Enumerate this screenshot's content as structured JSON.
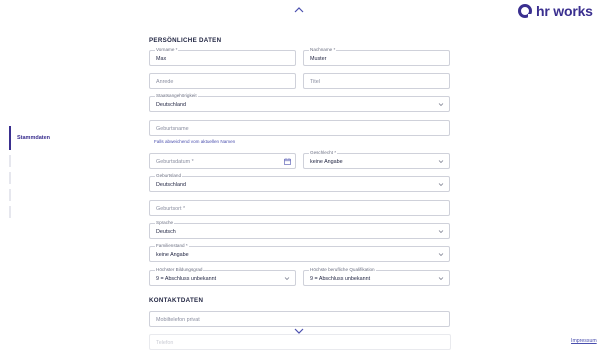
{
  "brand": {
    "logo_text": "hr works",
    "color": "#3a2f8f"
  },
  "nav": {
    "scroll_up_icon": "chevron-up-icon",
    "scroll_down_icon": "chevron-down-icon",
    "sidebar": {
      "active_label": "Stammdaten"
    }
  },
  "sections": {
    "personal": "PERSÖNLICHE DATEN",
    "contact": "KONTAKTDATEN"
  },
  "fields": {
    "vorname": {
      "label": "Vorname *",
      "value": "Max"
    },
    "nachname": {
      "label": "Nachname *",
      "value": "Muster"
    },
    "anrede": {
      "placeholder": "Anrede"
    },
    "titel": {
      "placeholder": "Titel"
    },
    "staatsangehoerigkeit": {
      "label": "Staatsangehörigkeit",
      "value": "Deutschland"
    },
    "geburtsname": {
      "placeholder": "Geburtsname",
      "hint": "Falls abweichend vom aktuellen Namen"
    },
    "geburtsdatum": {
      "placeholder": "Geburtsdatum *"
    },
    "geschlecht": {
      "label": "Geschlecht *",
      "value": "keine Angabe"
    },
    "geburtsland": {
      "label": "Geburtsland",
      "value": "Deutschland"
    },
    "geburtsort": {
      "placeholder": "Geburtsort *"
    },
    "sprache": {
      "label": "Sprache",
      "value": "Deutsch"
    },
    "familienstand": {
      "label": "Familienstand *",
      "value": "keine Angabe"
    },
    "bildungsgrad": {
      "label": "Höchster Bildungsgrad",
      "value": "9 = Abschluss unbekannt"
    },
    "qualifikation": {
      "label": "Höchste berufliche Qualifikation",
      "value": "9 = Abschluss unbekannt"
    },
    "mobiltelefon": {
      "placeholder": "Mobiltelefon privat"
    },
    "telefon": {
      "placeholder": "Telefon"
    }
  },
  "footer": {
    "impressum": "Impressum"
  }
}
